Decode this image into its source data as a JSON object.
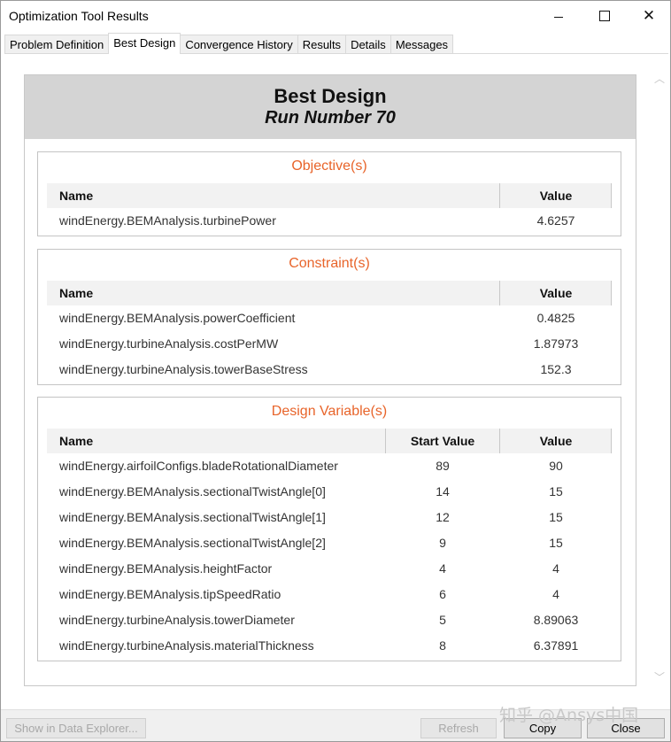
{
  "window": {
    "title": "Optimization Tool Results",
    "minimize_glyph": "–",
    "maximize_glyph": "□",
    "close_glyph": "✕"
  },
  "tabs": [
    {
      "label": "Problem Definition",
      "active": false
    },
    {
      "label": "Best Design",
      "active": true
    },
    {
      "label": "Convergence History",
      "active": false
    },
    {
      "label": "Results",
      "active": false
    },
    {
      "label": "Details",
      "active": false
    },
    {
      "label": "Messages",
      "active": false
    }
  ],
  "report": {
    "title": "Best Design",
    "subtitle": "Run Number 70",
    "objectives": {
      "title": "Objective(s)",
      "col_name": "Name",
      "col_value": "Value",
      "rows": [
        {
          "name": "windEnergy.BEMAnalysis.turbinePower",
          "value": "4.6257"
        }
      ]
    },
    "constraints": {
      "title": "Constraint(s)",
      "col_name": "Name",
      "col_value": "Value",
      "rows": [
        {
          "name": "windEnergy.BEMAnalysis.powerCoefficient",
          "value": "0.4825"
        },
        {
          "name": "windEnergy.turbineAnalysis.costPerMW",
          "value": "1.87973"
        },
        {
          "name": "windEnergy.turbineAnalysis.towerBaseStress",
          "value": "152.3"
        }
      ]
    },
    "design_variables": {
      "title": "Design Variable(s)",
      "col_name": "Name",
      "col_start": "Start Value",
      "col_value": "Value",
      "rows": [
        {
          "name": "windEnergy.airfoilConfigs.bladeRotationalDiameter",
          "start": "89",
          "value": "90"
        },
        {
          "name": "windEnergy.BEMAnalysis.sectionalTwistAngle[0]",
          "start": "14",
          "value": "15"
        },
        {
          "name": "windEnergy.BEMAnalysis.sectionalTwistAngle[1]",
          "start": "12",
          "value": "15"
        },
        {
          "name": "windEnergy.BEMAnalysis.sectionalTwistAngle[2]",
          "start": "9",
          "value": "15"
        },
        {
          "name": "windEnergy.BEMAnalysis.heightFactor",
          "start": "4",
          "value": "4"
        },
        {
          "name": "windEnergy.BEMAnalysis.tipSpeedRatio",
          "start": "6",
          "value": "4"
        },
        {
          "name": "windEnergy.turbineAnalysis.towerDiameter",
          "start": "5",
          "value": "8.89063"
        },
        {
          "name": "windEnergy.turbineAnalysis.materialThickness",
          "start": "8",
          "value": "6.37891"
        }
      ]
    }
  },
  "scrollbar": {
    "up_glyph": "︿",
    "down_glyph": "﹀"
  },
  "buttons": {
    "show_in_data_explorer": "Show in Data Explorer...",
    "refresh": "Refresh",
    "copy": "Copy",
    "close": "Close"
  },
  "watermark": "知乎 @Ansys中国",
  "colors": {
    "section_title": "#e8642a",
    "header_band": "#d4d4d4"
  }
}
